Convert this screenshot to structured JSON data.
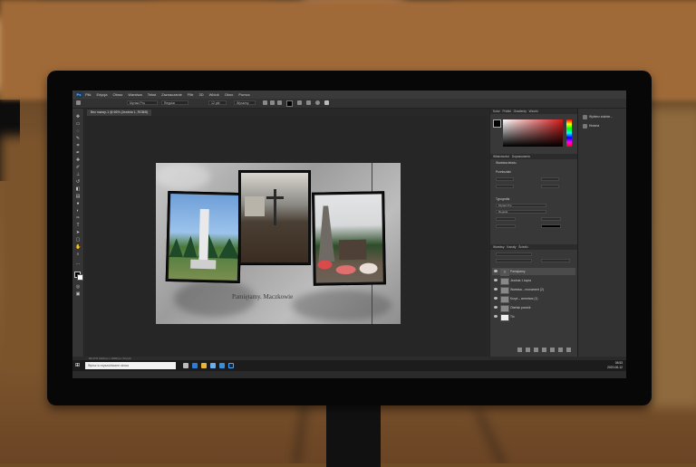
{
  "scene": {
    "description_colors": {
      "wood": "#a06a38",
      "monitor": "#070707",
      "ps_dark": "#2a2a2a"
    }
  },
  "app": {
    "menu": [
      "Plik",
      "Edycja",
      "Obraz",
      "Warstwa",
      "Tekst",
      "Zaznaczanie",
      "Filtr",
      "3D",
      "Widok",
      "Okno",
      "Pomoc"
    ],
    "document_tab": "Bez nazwy-1 @ 66% (Jezdnia 1, RGB/8)",
    "options": {
      "font_family": "Myriad Pro",
      "font_style": "Regular",
      "font_size": "12 pkt",
      "antialias": "Wyraźny"
    },
    "caption": "Pamiętamy. Maczkowie"
  },
  "panels": {
    "color_tabs": [
      "Kolor",
      "Próbki",
      "Gradienty",
      "Wzorki"
    ],
    "properties_tabs": [
      "Właściwości",
      "Dopasowania"
    ],
    "properties_title": "Warstwa tekstu",
    "sections": [
      "Przekształć",
      "Typografia"
    ],
    "typography_font": "Myriad Pro",
    "typography_style": "Regular",
    "layers_tabs": [
      "Warstwy",
      "Kanały",
      "Ścieżki"
    ],
    "layers": [
      {
        "name": "Pamiętamy"
      },
      {
        "name": "Jezdnia 1 kopia"
      },
      {
        "name": "Warstwa – monument (2)"
      },
      {
        "name": "Krzyż – cmentarz (1)"
      },
      {
        "name": "Obelisk pomnik"
      },
      {
        "name": "Tło"
      }
    ],
    "side": [
      "Wybierz zdalnie...",
      "Historia"
    ]
  },
  "status": "66,67%   1920 px x 1080 px (72 ppi)",
  "taskbar": {
    "search_placeholder": "Wpisz tu wyszukiwane słowa",
    "time": "08:53",
    "date": "2020-06-12"
  }
}
